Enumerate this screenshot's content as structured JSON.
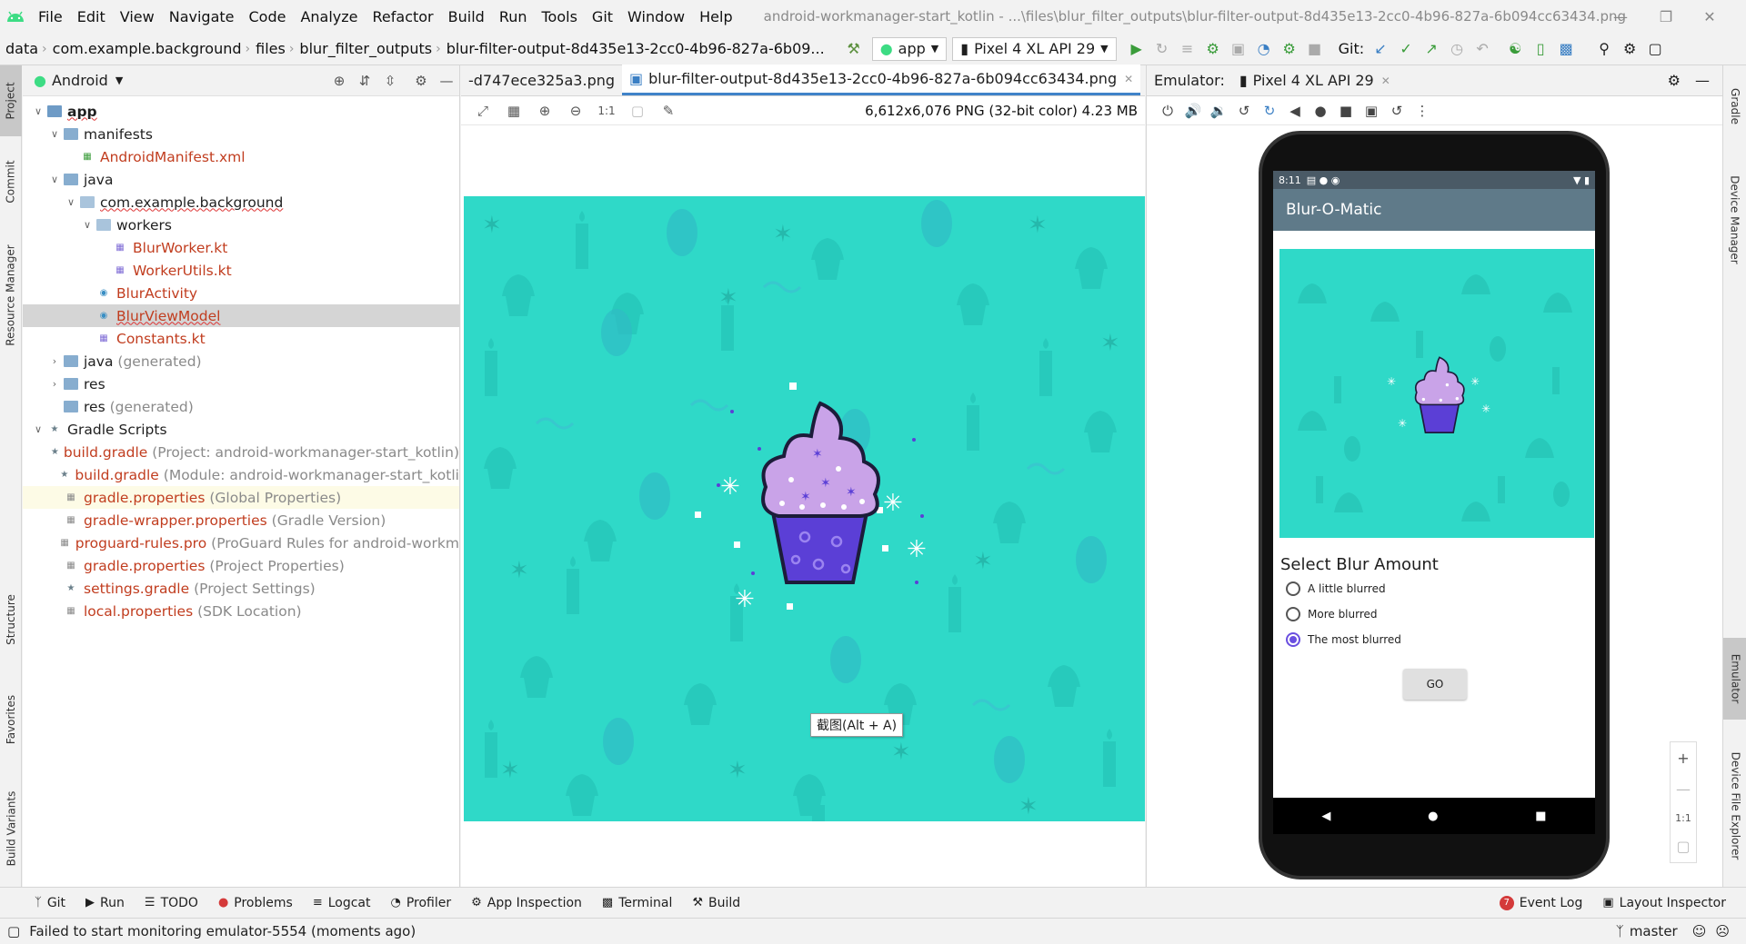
{
  "menubar": {
    "items": [
      "File",
      "Edit",
      "View",
      "Navigate",
      "Code",
      "Analyze",
      "Refactor",
      "Build",
      "Run",
      "Tools",
      "Git",
      "Window",
      "Help"
    ],
    "window_title": "android-workmanager-start_kotlin - ...\\files\\blur_filter_outputs\\blur-filter-output-8d435e13-2cc0-4b96-827a-6b094cc63434.png"
  },
  "navbar": {
    "crumbs": [
      "data",
      "com.example.background",
      "files",
      "blur_filter_outputs",
      "blur-filter-output-8d435e13-2cc0-4b96-827a-6b09..."
    ],
    "run_config": "app",
    "device": "Pixel 4 XL API 29",
    "git_label": "Git:"
  },
  "left_tool_tabs": [
    "Project",
    "Commit",
    "Resource Manager",
    "Structure",
    "Favorites",
    "Build Variants"
  ],
  "right_tool_tabs": [
    "Gradle",
    "Device Manager",
    "Emulator",
    "Device File Explorer"
  ],
  "project": {
    "view_label": "Android",
    "tree": [
      {
        "label": "app",
        "depth": 0,
        "expanded": true,
        "kind": "module"
      },
      {
        "label": "manifests",
        "depth": 1,
        "expanded": true,
        "kind": "folder"
      },
      {
        "label": "AndroidManifest.xml",
        "depth": 2,
        "kind": "manifest"
      },
      {
        "label": "java",
        "depth": 1,
        "expanded": true,
        "kind": "folder"
      },
      {
        "label": "com.example.background",
        "depth": 2,
        "expanded": true,
        "kind": "package"
      },
      {
        "label": "workers",
        "depth": 3,
        "expanded": true,
        "kind": "package"
      },
      {
        "label": "BlurWorker.kt",
        "depth": 4,
        "kind": "kotlin"
      },
      {
        "label": "WorkerUtils.kt",
        "depth": 4,
        "kind": "kotlin"
      },
      {
        "label": "BlurActivity",
        "depth": 3,
        "kind": "class"
      },
      {
        "label": "BlurViewModel",
        "depth": 3,
        "kind": "class",
        "selected": true
      },
      {
        "label": "Constants.kt",
        "depth": 3,
        "kind": "kotlin"
      },
      {
        "label": "java",
        "suffix": "(generated)",
        "depth": 1,
        "expanded": false,
        "kind": "folder"
      },
      {
        "label": "res",
        "depth": 1,
        "expanded": false,
        "kind": "folder"
      },
      {
        "label": "res",
        "suffix": "(generated)",
        "depth": 1,
        "kind": "folder"
      },
      {
        "label": "Gradle Scripts",
        "depth": 0,
        "expanded": true,
        "kind": "gradle"
      },
      {
        "label": "build.gradle",
        "suffix": "(Project: android-workmanager-start_kotlin)",
        "depth": 1,
        "kind": "gradle"
      },
      {
        "label": "build.gradle",
        "suffix": "(Module: android-workmanager-start_kotli",
        "depth": 1,
        "kind": "gradle"
      },
      {
        "label": "gradle.properties",
        "suffix": "(Global Properties)",
        "depth": 1,
        "kind": "props",
        "highlight": true
      },
      {
        "label": "gradle-wrapper.properties",
        "suffix": "(Gradle Version)",
        "depth": 1,
        "kind": "props"
      },
      {
        "label": "proguard-rules.pro",
        "suffix": "(ProGuard Rules for android-workm",
        "depth": 1,
        "kind": "props"
      },
      {
        "label": "gradle.properties",
        "suffix": "(Project Properties)",
        "depth": 1,
        "kind": "props"
      },
      {
        "label": "settings.gradle",
        "suffix": "(Project Settings)",
        "depth": 1,
        "kind": "gradle"
      },
      {
        "label": "local.properties",
        "suffix": "(SDK Location)",
        "depth": 1,
        "kind": "props"
      }
    ]
  },
  "editor": {
    "tabs": [
      {
        "label": "-d747ece325a3.png",
        "active": false
      },
      {
        "label": "blur-filter-output-8d435e13-2cc0-4b96-827a-6b094cc63434.png",
        "active": true
      }
    ],
    "image_info": "6,612x6,076 PNG (32-bit color) 4.23 MB",
    "zoom_actual": "1:1",
    "tooltip": "截图(Alt + A)"
  },
  "emulator": {
    "label": "Emulator:",
    "device_tab": "Pixel 4 XL API 29",
    "time": "8:11",
    "app_title": "Blur-O-Matic",
    "select_title": "Select Blur Amount",
    "options": [
      {
        "label": "A little blurred",
        "checked": false
      },
      {
        "label": "More blurred",
        "checked": false
      },
      {
        "label": "The most blurred",
        "checked": true
      }
    ],
    "go_label": "GO",
    "zoom_actual": "1:1"
  },
  "bottom_tools": [
    "Git",
    "Run",
    "TODO",
    "Problems",
    "Logcat",
    "Profiler",
    "App Inspection",
    "Terminal",
    "Build"
  ],
  "bottom_right": {
    "event_log": "Event Log",
    "event_count": "7",
    "layout_inspector": "Layout Inspector"
  },
  "status": {
    "message": "Failed to start monitoring emulator-5554 (moments ago)",
    "branch": "master"
  },
  "colors": {
    "canvas_bg": "#2fd9c8",
    "accent": "#4083c9",
    "app_bar": "#5f7a89",
    "radio_checked": "#6a4fe0"
  }
}
